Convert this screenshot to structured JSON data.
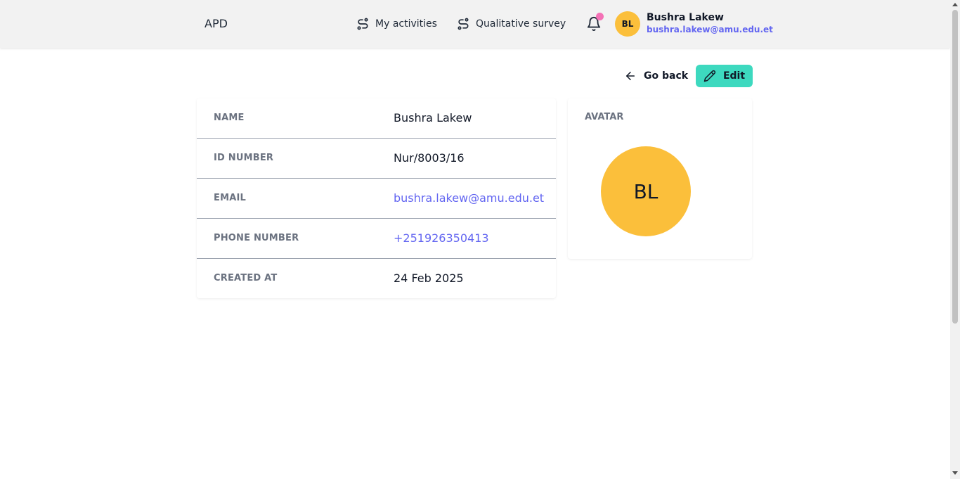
{
  "header": {
    "brand": "APD",
    "nav": [
      {
        "label": "My activities",
        "icon": "route-icon"
      },
      {
        "label": "Qualitative survey",
        "icon": "route-icon"
      }
    ],
    "notification_icon": "bell-icon",
    "user": {
      "initials": "BL",
      "name": "Bushra Lakew",
      "email": "bushra.lakew@amu.edu.et"
    }
  },
  "actions": {
    "go_back": "Go back",
    "edit": "Edit"
  },
  "profile": {
    "rows": [
      {
        "label": "NAME",
        "value": "Bushra Lakew"
      },
      {
        "label": "ID NUMBER",
        "value": "Nur/8003/16"
      },
      {
        "label": "EMAIL",
        "value": "bushra.lakew@amu.edu.et"
      },
      {
        "label": "PHONE NUMBER",
        "value": "+251926350413"
      },
      {
        "label": "CREATED AT",
        "value": "24 Feb 2025"
      }
    ],
    "avatar_label": "AVATAR",
    "avatar_initials": "BL"
  },
  "colors": {
    "accent": "#3dd9bf",
    "link": "#6366f1",
    "avatar": "#fbbf3b",
    "notification_dot": "#f472b6"
  }
}
